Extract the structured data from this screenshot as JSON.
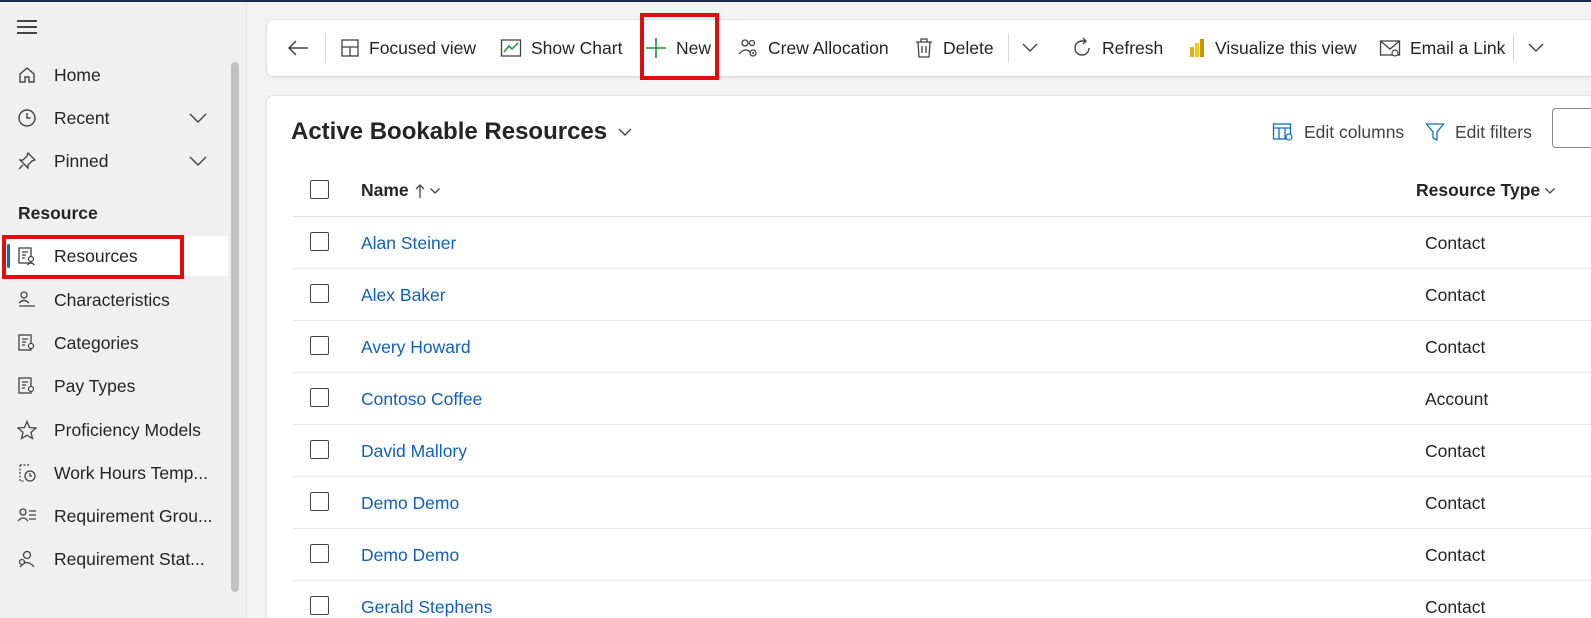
{
  "sidebar": {
    "nav": [
      {
        "label": "Home",
        "icon": "home-icon"
      },
      {
        "label": "Recent",
        "icon": "clock-icon"
      },
      {
        "label": "Pinned",
        "icon": "pin-icon"
      }
    ],
    "section_label": "Resource",
    "items": [
      {
        "label": "Resources",
        "icon": "resource-list-icon",
        "selected": true
      },
      {
        "label": "Characteristics",
        "icon": "person-characteristic-icon"
      },
      {
        "label": "Categories",
        "icon": "category-list-icon"
      },
      {
        "label": "Pay Types",
        "icon": "pay-type-list-icon"
      },
      {
        "label": "Proficiency Models",
        "icon": "star-icon"
      },
      {
        "label": "Work Hours Temp...",
        "icon": "work-hours-icon"
      },
      {
        "label": "Requirement Grou...",
        "icon": "requirement-group-icon"
      },
      {
        "label": "Requirement Stat...",
        "icon": "requirement-status-icon"
      }
    ]
  },
  "commandbar": {
    "focused_view": "Focused view",
    "show_chart": "Show Chart",
    "new": "New",
    "crew_allocation": "Crew Allocation",
    "delete": "Delete",
    "refresh": "Refresh",
    "visualize": "Visualize this view",
    "email_link": "Email a Link"
  },
  "view": {
    "title": "Active Bookable Resources",
    "edit_columns": "Edit columns",
    "edit_filters": "Edit filters",
    "columns": {
      "name": "Name",
      "type": "Resource Type"
    },
    "rows": [
      {
        "name": "Alan Steiner",
        "type": "Contact"
      },
      {
        "name": "Alex Baker",
        "type": "Contact"
      },
      {
        "name": "Avery Howard",
        "type": "Contact"
      },
      {
        "name": "Contoso Coffee",
        "type": "Account"
      },
      {
        "name": "David Mallory",
        "type": "Contact"
      },
      {
        "name": "Demo Demo",
        "type": "Contact"
      },
      {
        "name": "Demo Demo",
        "type": "Contact"
      },
      {
        "name": "Gerald Stephens",
        "type": "Contact"
      }
    ]
  },
  "colors": {
    "accent": "#0f6cbd",
    "link": "#1160b7",
    "highlight": "#e00d0d"
  }
}
